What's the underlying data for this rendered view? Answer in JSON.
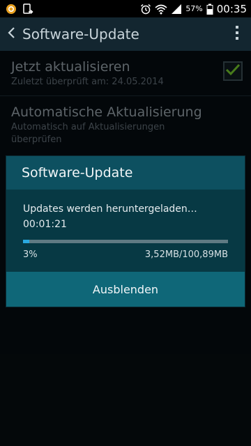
{
  "status_bar": {
    "battery_percent": "57%",
    "time": "00:35",
    "icons": [
      "app-notification-icon",
      "update-notification-icon",
      "alarm-icon",
      "wifi-icon",
      "signal-icon",
      "battery-icon"
    ]
  },
  "action_bar": {
    "title": "Software-Update",
    "back_icon": "chevron-left-icon",
    "menu_icon": "overflow-menu-icon"
  },
  "settings": {
    "update_now": {
      "title": "Jetzt aktualisieren",
      "subtitle": "Zuletzt überprüft am: 24.05.2014"
    },
    "auto_update": {
      "title": "Automatische Aktualisierung",
      "subtitle": "Automatisch auf Aktualisierungen überprüfen",
      "checked": true
    }
  },
  "dialog": {
    "title": "Software-Update",
    "message": "Updates werden heruntergeladen…",
    "elapsed": "00:01:21",
    "progress_fraction": 0.03,
    "progress_percent": "3%",
    "progress_size": "3,52MB/100,89MB",
    "button_label": "Ausblenden"
  },
  "colors": {
    "background": "#060c10",
    "action_bar": "#132630",
    "dialog": "#073944",
    "dialog_title": "#0d5060",
    "dialog_button": "#0f6778",
    "progress": "#2aa9e0",
    "checkmark": "#6fbf2a"
  }
}
